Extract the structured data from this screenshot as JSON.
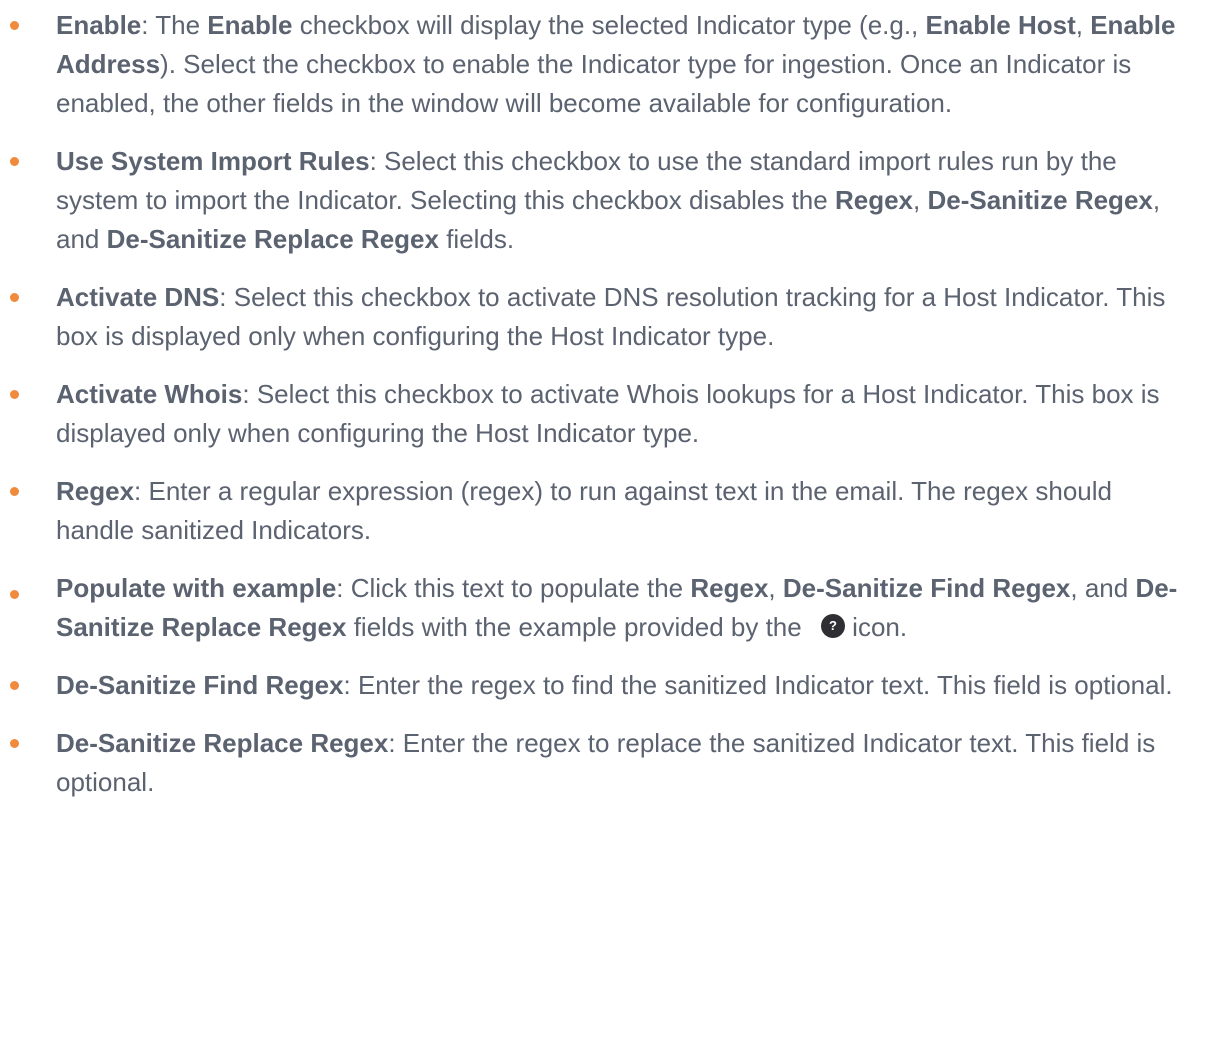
{
  "colors": {
    "bullet": "#f08a3c",
    "text": "#5b6270",
    "help_icon_bg": "#2f2f33"
  },
  "icons": {
    "bullet": "bullet-dot-icon",
    "help": "question-mark-circle-icon"
  },
  "items": [
    {
      "term": "Enable",
      "t1": ": The ",
      "b1": "Enable",
      "t2": " checkbox will display the selected Indicator type (e.g., ",
      "b2": "Enable Host",
      "t3": ", ",
      "b3": "Enable Address",
      "t4": "). Select the checkbox to enable the Indicator type for ingestion. Once an Indicator is enabled, the other fields in the window will become available for configuration."
    },
    {
      "term": "Use System Import Rules",
      "t1": ": Select this checkbox to use the standard import rules run by the system to import the Indicator. Selecting this checkbox disables the ",
      "b1": "Regex",
      "t2": ", ",
      "b2": "De-Sanitize Regex",
      "t3": ", and ",
      "b3": "De-Sanitize Replace Regex",
      "t4": " fields."
    },
    {
      "term": "Activate DNS",
      "t1": ": Select this checkbox to activate DNS resolution tracking for a Host Indicator. This box is displayed only when configuring the Host Indicator type."
    },
    {
      "term": "Activate Whois",
      "t1": ": Select this checkbox to activate Whois lookups for a Host Indicator. This box is displayed only when configuring the Host Indicator type."
    },
    {
      "term": "Regex",
      "t1": ": Enter a regular expression (regex) to run against text in the email. The regex should handle sanitized Indicators."
    },
    {
      "term": "Populate with example",
      "t1": ": Click this text to populate the ",
      "b1": "Regex",
      "t2": ", ",
      "b2": "De-Sanitize Find Regex",
      "t3": ", and ",
      "b3": "De-Sanitize Replace Regex",
      "t4": " fields with the example provided by the ",
      "icon_glyph": "?",
      "t5": " icon."
    },
    {
      "term": "De-Sanitize Find Regex",
      "t1": ": Enter the regex to find the sanitized Indicator text. This field is optional."
    },
    {
      "term": "De-Sanitize Replace Regex",
      "t1": ": Enter the regex to replace the sanitized Indicator text. This field is optional."
    }
  ]
}
